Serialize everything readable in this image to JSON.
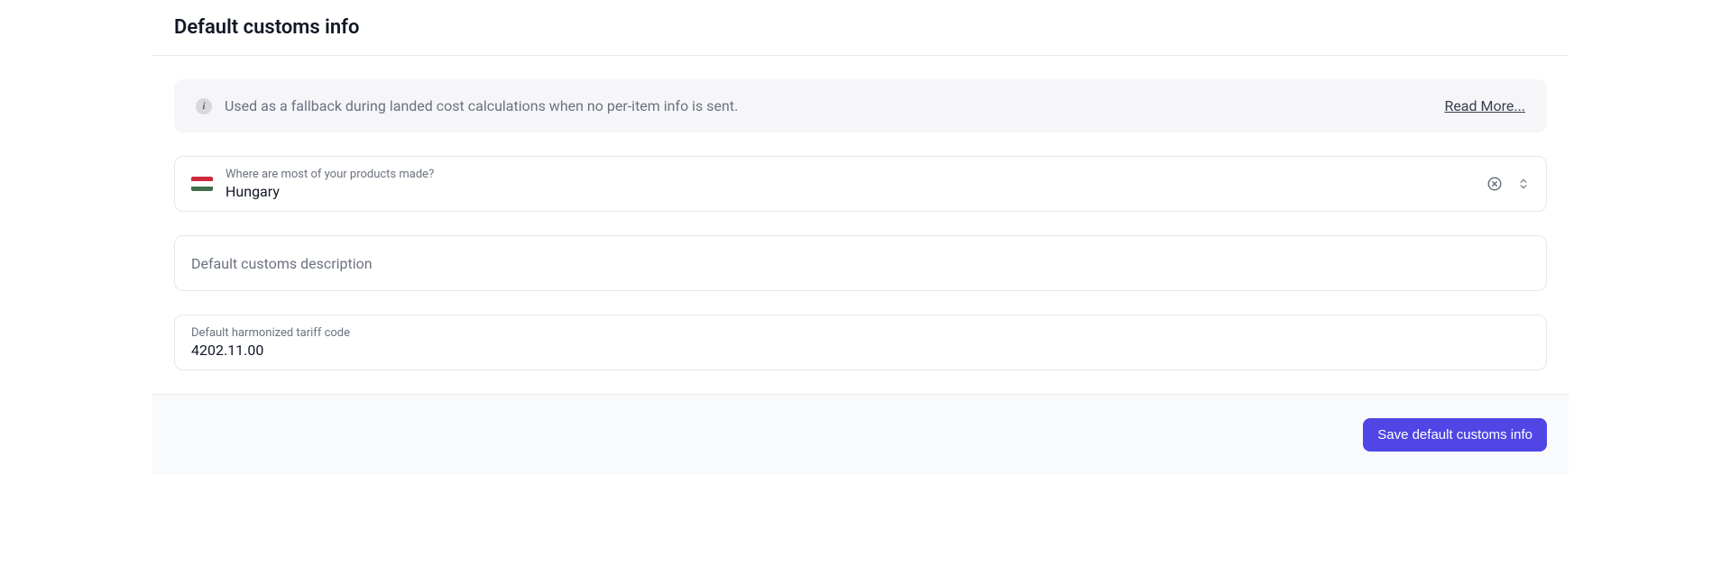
{
  "header": {
    "title": "Default customs info"
  },
  "alert": {
    "text": "Used as a fallback during landed cost calculations when no per-item info is sent.",
    "link": "Read More..."
  },
  "origin_field": {
    "label": "Where are most of your products made?",
    "value": "Hungary"
  },
  "description_field": {
    "placeholder": "Default customs description",
    "value": ""
  },
  "tariff_field": {
    "label": "Default harmonized tariff code",
    "value": "4202.11.00"
  },
  "footer": {
    "save_label": "Save default customs info"
  }
}
